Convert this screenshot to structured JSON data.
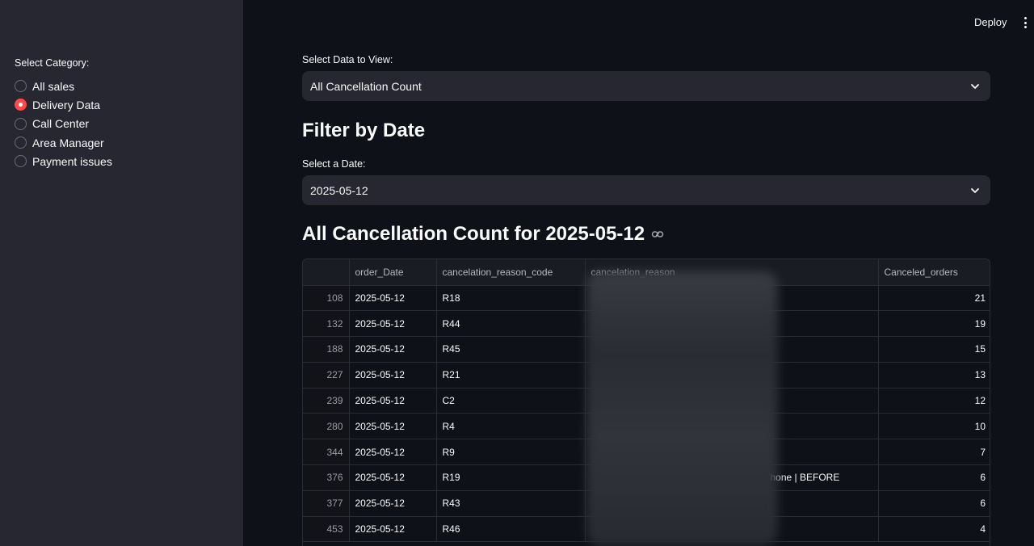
{
  "header": {
    "deploy_label": "Deploy",
    "menu_icon": "kebab-menu-icon"
  },
  "sidebar": {
    "label": "Select Category:",
    "options": [
      {
        "label": "All sales",
        "selected": false
      },
      {
        "label": "Delivery Data",
        "selected": true
      },
      {
        "label": "Call Center",
        "selected": false
      },
      {
        "label": "Area Manager",
        "selected": false
      },
      {
        "label": "Payment issues",
        "selected": false
      }
    ]
  },
  "main": {
    "data_select": {
      "label": "Select Data to View:",
      "value": "All Cancellation Count"
    },
    "filter_title": "Filter by Date",
    "date_select": {
      "label": "Select a Date:",
      "value": "2025-05-12"
    },
    "table_title": "All Cancellation Count for 2025-05-12",
    "table": {
      "columns": [
        "",
        "order_Date",
        "cancelation_reason_code",
        "cancelation_reason",
        "Canceled_orders"
      ],
      "rows": [
        {
          "index": "108",
          "order_date": "2025-05-12",
          "code": "R18",
          "reason": "",
          "canceled": "21"
        },
        {
          "index": "132",
          "order_date": "2025-05-12",
          "code": "R44",
          "reason": "",
          "canceled": "19"
        },
        {
          "index": "188",
          "order_date": "2025-05-12",
          "code": "R45",
          "reason": "",
          "canceled": "15"
        },
        {
          "index": "227",
          "order_date": "2025-05-12",
          "code": "R21",
          "reason": "",
          "canceled": "13"
        },
        {
          "index": "239",
          "order_date": "2025-05-12",
          "code": "C2",
          "reason": "",
          "canceled": "12"
        },
        {
          "index": "280",
          "order_date": "2025-05-12",
          "code": "R4",
          "reason": "",
          "canceled": "10"
        },
        {
          "index": "344",
          "order_date": "2025-05-12",
          "code": "R9",
          "reason": "",
          "canceled": "7"
        },
        {
          "index": "376",
          "order_date": "2025-05-12",
          "code": "R19",
          "reason": "hone | BEFORE",
          "canceled": "6"
        },
        {
          "index": "377",
          "order_date": "2025-05-12",
          "code": "R43",
          "reason": "",
          "canceled": "6"
        },
        {
          "index": "453",
          "order_date": "2025-05-12",
          "code": "R46",
          "reason": "",
          "canceled": "4"
        }
      ]
    }
  },
  "colors": {
    "accent": "#ff4b4b",
    "background": "#0e1117",
    "sidebar": "#262730"
  }
}
